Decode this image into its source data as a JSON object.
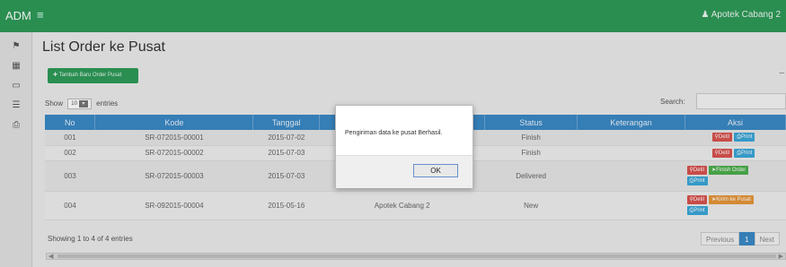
{
  "topbar": {
    "brand": "ADM",
    "menu_icon": "hamburger-icon",
    "user": "Apotek Cabang 2",
    "user_icon": "user-icon"
  },
  "sidebar": {
    "icons": [
      "home-icon",
      "grid-icon",
      "monitor-icon",
      "list-icon",
      "print-icon"
    ]
  },
  "page": {
    "title": "List Order ke Pusat"
  },
  "toolbar": {
    "add_label": "Tambah Baru Order Pusat"
  },
  "table_controls": {
    "show": "Show",
    "length_value": "10",
    "entries": "entries",
    "search_label": "Search:"
  },
  "table": {
    "headers": [
      "No",
      "Kode",
      "Tanggal",
      "",
      "Status",
      "Keterangan",
      "Aksi"
    ],
    "rows": [
      {
        "no": "001",
        "kode": "SR-072015-00001",
        "tanggal": "2015-07-02",
        "tujuan": "",
        "status": "Finish",
        "keterangan": ""
      },
      {
        "no": "002",
        "kode": "SR-072015-00002",
        "tanggal": "2015-07-03",
        "tujuan": "",
        "status": "Finish",
        "keterangan": ""
      },
      {
        "no": "003",
        "kode": "SR-072015-00003",
        "tanggal": "2015-07-03",
        "tujuan": "",
        "status": "Delivered",
        "keterangan": ""
      },
      {
        "no": "004",
        "kode": "SR-092015-00004",
        "tanggal": "2015-05-16",
        "tujuan": "Apotek Cabang 2",
        "status": "New",
        "keterangan": ""
      }
    ],
    "actions": {
      "detil": "Detil",
      "print": "Print",
      "finish": "Finish Order",
      "kirim": "Kirim ke Pusat"
    }
  },
  "footer": {
    "info": "Showing 1 to 4 of 4 entries",
    "previous": "Previous",
    "page": "1",
    "next": "Next"
  },
  "dialog": {
    "message": "Pengiriman data ke pusat Berhasil.",
    "ok": "OK"
  },
  "colors": {
    "brand_green": "#2e9b58",
    "header_blue": "#3a89c6",
    "danger": "#d9534f",
    "info": "#3aa6d8",
    "success": "#4cae4c",
    "warning": "#e6963a"
  }
}
